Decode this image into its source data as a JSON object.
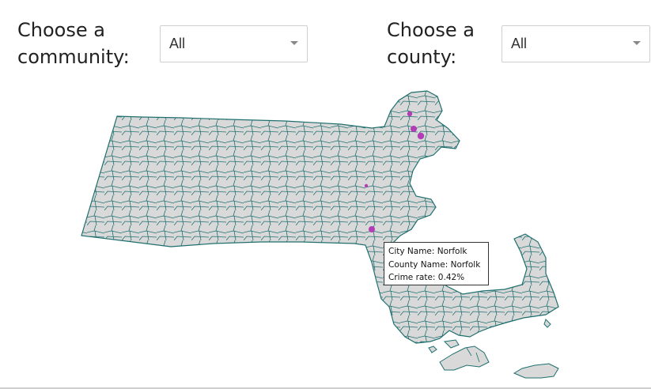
{
  "filters": {
    "community": {
      "label": "Choose a\ncommunity:",
      "value": "All"
    },
    "county": {
      "label": "Choose a\ncounty:",
      "value": "All"
    }
  },
  "map": {
    "fill": "#d9d9d9",
    "border": "#1f6f6f",
    "marker_color": "#b23db5",
    "markers": [
      {
        "r": 3.2
      },
      {
        "r": 4.0
      },
      {
        "r": 4.2
      },
      {
        "r": 2.2
      },
      {
        "r": 4.0
      }
    ]
  },
  "tooltip": {
    "city": "City Name: Norfolk",
    "county": "County Name: Norfolk",
    "crime": "Crime rate: 0.42%"
  }
}
